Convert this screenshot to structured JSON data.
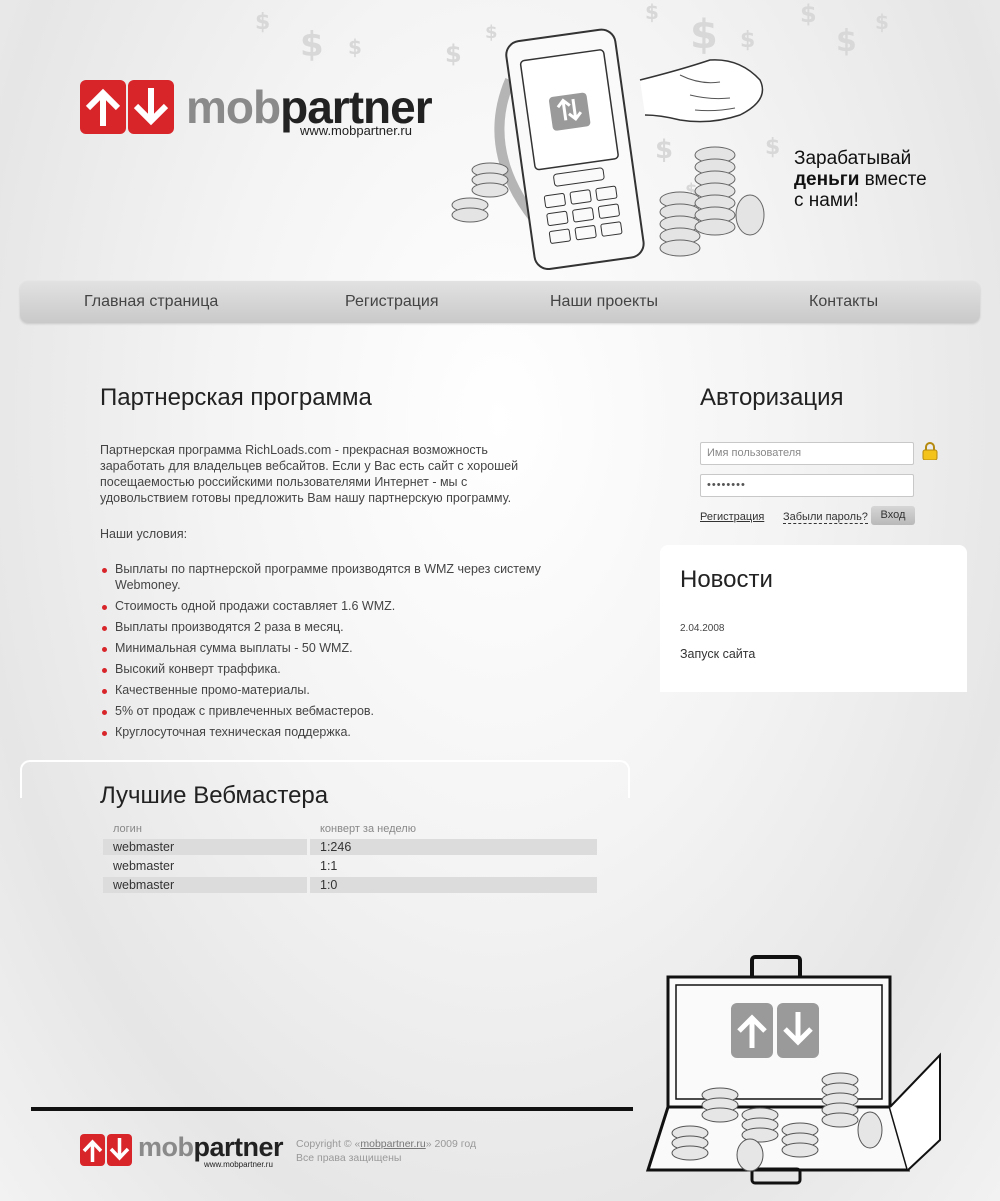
{
  "header": {
    "brand_prefix": "mob",
    "brand_suffix": "partner",
    "url": "www.mobpartner.ru",
    "slogan_line1": "Зарабатывай",
    "slogan_bold": "деньги",
    "slogan_rest": " вместе",
    "slogan_line3": "с нами!"
  },
  "nav": [
    {
      "label": "Главная страница"
    },
    {
      "label": "Регистрация"
    },
    {
      "label": "Наши проекты"
    },
    {
      "label": "Контакты"
    }
  ],
  "program": {
    "title": "Партнерская программа",
    "intro": "Партнерская программа RichLoads.com - прекрасная возможность заработать для владельцев вебсайтов. Если у Вас есть сайт с хорошей посещаемостью российскими пользователями Интернет - мы с удовольствием готовы предложить Вам нашу партнерскую программу.",
    "conditions_label": "Наши условия:",
    "conditions": [
      "Выплаты по партнерской программе производятся в WMZ через систему Webmoney.",
      "Стоимость одной продажи составляет 1.6 WMZ.",
      "Выплаты производятся 2 раза в месяц.",
      "Минимальная сумма выплаты - 50 WMZ.",
      "Высокий конверт траффика.",
      "Качественные промо-материалы.",
      "5% от продаж с привлеченных вебмастеров.",
      "Круглосуточная техническая поддержка."
    ]
  },
  "webmasters": {
    "title": "Лучшие Вебмастера",
    "col_login": "логин",
    "col_conv": "конверт за неделю",
    "rows": [
      {
        "login": "webmaster",
        "conv": "1:246"
      },
      {
        "login": "webmaster",
        "conv": "1:1"
      },
      {
        "login": "webmaster",
        "conv": "1:0"
      }
    ]
  },
  "auth": {
    "title": "Авторизация",
    "username_placeholder": "Имя пользователя",
    "password_value": "••••••••",
    "register_link": "Регистрация",
    "forgot_link": "Забыли пароль?",
    "login_button": "Вход"
  },
  "news": {
    "title": "Новости",
    "items": [
      {
        "date": "2.04.2008",
        "text": "Запуск сайта"
      }
    ]
  },
  "footer": {
    "copyright_prefix": "Copyright © «",
    "copyright_link": "mobpartner.ru",
    "copyright_suffix": "» 2009 год",
    "rights": "Все права защищены"
  },
  "colors": {
    "brand_red": "#d8252a",
    "bullet_red": "#d8252a",
    "nav_bg": "#d0d0d0"
  }
}
